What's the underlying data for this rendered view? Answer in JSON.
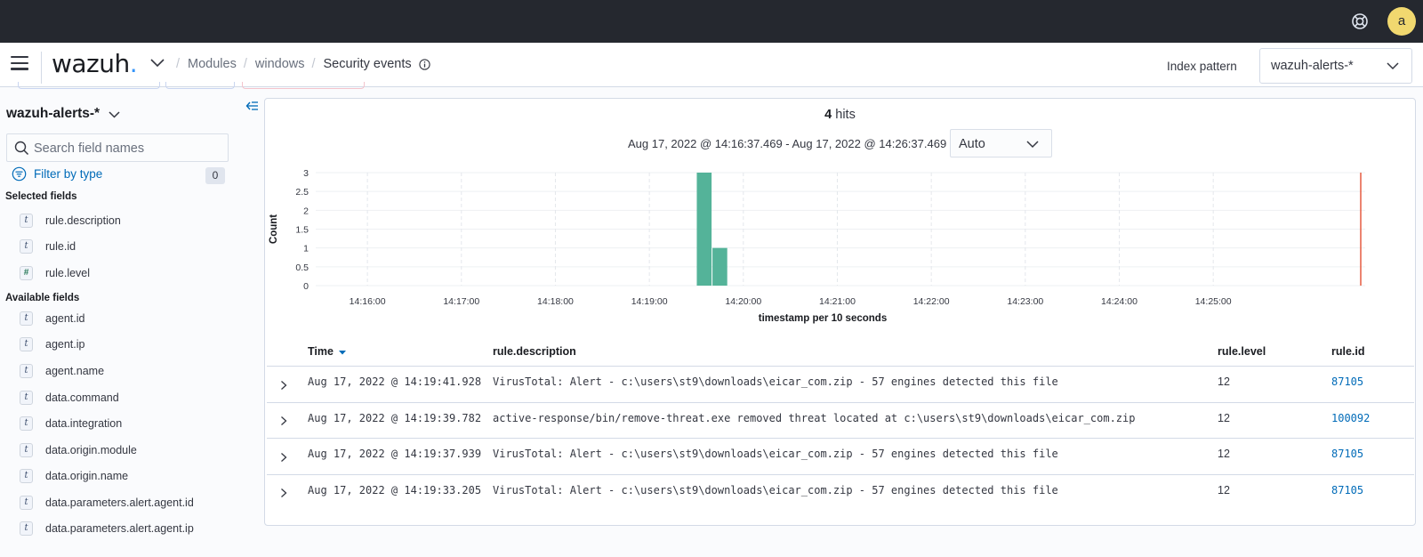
{
  "topbar": {
    "avatar_initial": "a",
    "help_icon": "help-lifebuoy-icon"
  },
  "header": {
    "logo_text": "wazuh",
    "logo_dot": ".",
    "breadcrumbs": [
      "Modules",
      "windows",
      "Security events"
    ],
    "index_pattern_label": "Index pattern",
    "index_pattern_value": "wazuh-alerts-*"
  },
  "sidebar": {
    "index_name": "wazuh-alerts-*",
    "search_placeholder": "Search field names",
    "filter_label": "Filter by type",
    "filter_count": "0",
    "selected_heading": "Selected fields",
    "selected_fields": [
      {
        "type": "t",
        "name": "rule.description"
      },
      {
        "type": "t",
        "name": "rule.id"
      },
      {
        "type": "#",
        "name": "rule.level"
      }
    ],
    "available_heading": "Available fields",
    "available_fields": [
      {
        "type": "t",
        "name": "agent.id"
      },
      {
        "type": "t",
        "name": "agent.ip"
      },
      {
        "type": "t",
        "name": "agent.name"
      },
      {
        "type": "t",
        "name": "data.command"
      },
      {
        "type": "t",
        "name": "data.integration"
      },
      {
        "type": "t",
        "name": "data.origin.module"
      },
      {
        "type": "t",
        "name": "data.origin.name"
      },
      {
        "type": "t",
        "name": "data.parameters.alert.agent.id"
      },
      {
        "type": "t",
        "name": "data.parameters.alert.agent.ip"
      }
    ]
  },
  "summary": {
    "hits_count": "4",
    "hits_label": "hits",
    "time_range": "Aug 17, 2022 @ 14:16:37.469 - Aug 17, 2022 @ 14:26:37.469",
    "interval": "Auto"
  },
  "chart_data": {
    "type": "bar",
    "ylabel": "Count",
    "xlabel": "timestamp per 10 seconds",
    "ylim": [
      0,
      3
    ],
    "yticks": [
      "0",
      "0.5",
      "1",
      "1.5",
      "2",
      "2.5",
      "3"
    ],
    "xticks": [
      "14:16:00",
      "14:17:00",
      "14:18:00",
      "14:19:00",
      "14:20:00",
      "14:21:00",
      "14:22:00",
      "14:23:00",
      "14:24:00",
      "14:25:00"
    ],
    "x_start": "14:15:27",
    "x_end": "14:26:37",
    "grid": true,
    "bars": [
      {
        "x": "14:19:30",
        "value": 3
      },
      {
        "x": "14:19:40",
        "value": 1
      }
    ],
    "now_marker": "14:26:37",
    "bar_color": "#54b399",
    "marker_color": "#e7664c"
  },
  "table": {
    "columns": {
      "time": "Time",
      "description": "rule.description",
      "level": "rule.level",
      "id": "rule.id"
    },
    "rows": [
      {
        "time": "Aug 17, 2022 @ 14:19:41.928",
        "description": "VirusTotal: Alert - c:\\users\\st9\\downloads\\eicar_com.zip - 57 engines detected this file",
        "level": "12",
        "id": "87105"
      },
      {
        "time": "Aug 17, 2022 @ 14:19:39.782",
        "description": "active-response/bin/remove-threat.exe removed threat located at c:\\users\\st9\\downloads\\eicar_com.zip",
        "level": "12",
        "id": "100092"
      },
      {
        "time": "Aug 17, 2022 @ 14:19:37.939",
        "description": "VirusTotal: Alert - c:\\users\\st9\\downloads\\eicar_com.zip - 57 engines detected this file",
        "level": "12",
        "id": "87105"
      },
      {
        "time": "Aug 17, 2022 @ 14:19:33.205",
        "description": "VirusTotal: Alert - c:\\users\\st9\\downloads\\eicar_com.zip - 57 engines detected this file",
        "level": "12",
        "id": "87105"
      }
    ]
  }
}
